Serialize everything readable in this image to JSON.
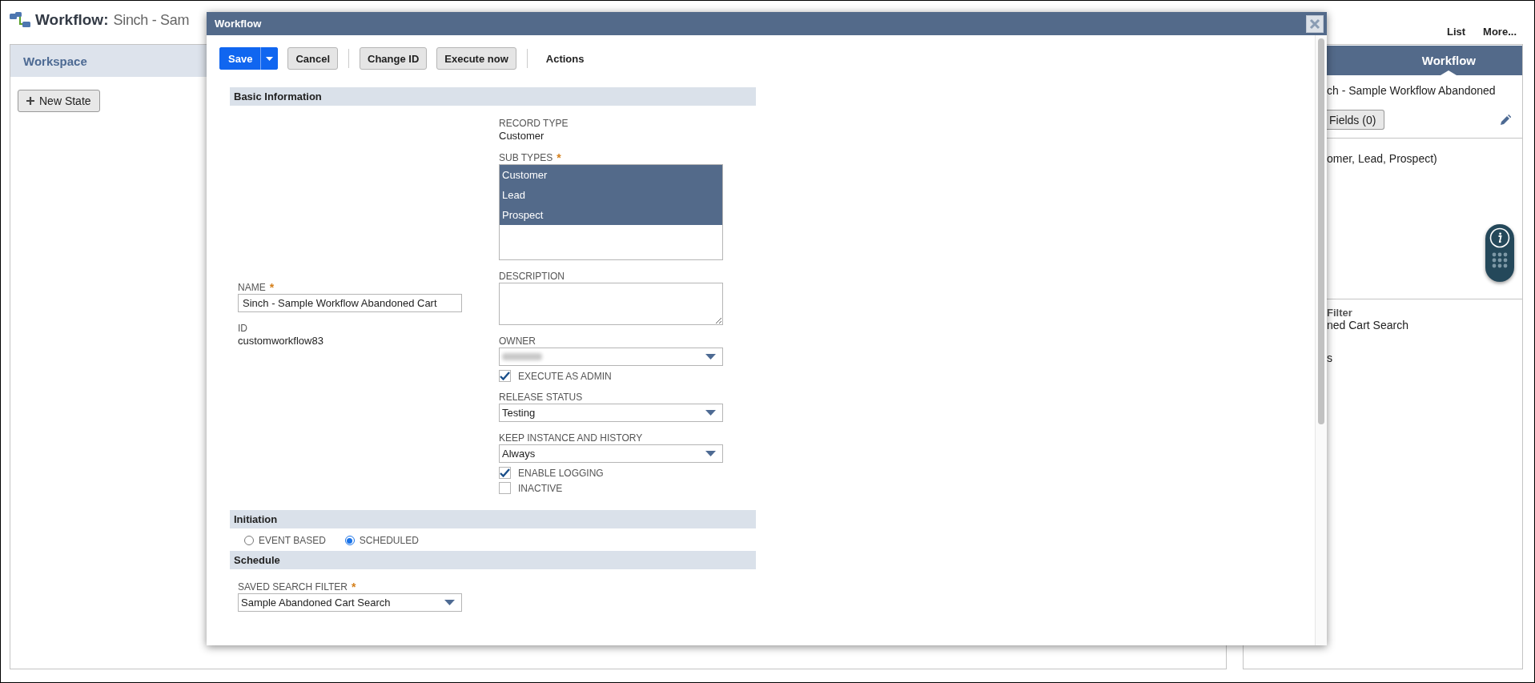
{
  "page_header": {
    "title": "Workflow:",
    "name": "Sinch - Sam"
  },
  "top_links": [
    "List",
    "More..."
  ],
  "workspace": {
    "title": "Workspace",
    "new_state_button": "New State"
  },
  "side_panel": {
    "tab": "Workflow",
    "name": "ch - Sample Workflow Abandoned",
    "fields_button": "Fields (0)",
    "sub_types": "omer, Lead, Prospect)",
    "filter_label": "Filter",
    "filter_value": "ned Cart Search",
    "text_3": "s"
  },
  "dialog": {
    "title": "Workflow",
    "toolbar": [
      [
        {
          "label": "Save",
          "kind": "split"
        },
        {
          "label": "Cancel",
          "kind": "button"
        }
      ],
      [
        {
          "label": "Change ID",
          "kind": "button"
        },
        {
          "label": "Execute now",
          "kind": "button"
        }
      ],
      [
        {
          "label": "Actions",
          "kind": "menu"
        }
      ]
    ],
    "sections": [
      {
        "title": "Basic Information",
        "kind": "columns",
        "left": [
          {
            "kind": "text",
            "label": "NAME",
            "required_mark": "*",
            "value": "Sinch - Sample Workflow Abandoned Cart"
          },
          {
            "kind": "static",
            "label": "ID",
            "value": "customworkflow83"
          }
        ],
        "right": [
          {
            "kind": "static",
            "label": "RECORD TYPE",
            "value": "Customer"
          },
          {
            "kind": "multiselect",
            "label": "SUB TYPES",
            "required_mark": "*",
            "options": [
              {
                "label": "Customer",
                "selected": true
              },
              {
                "label": "Lead",
                "selected": true
              },
              {
                "label": "Prospect",
                "selected": true
              }
            ]
          },
          {
            "kind": "textarea",
            "label": "DESCRIPTION"
          },
          {
            "kind": "select",
            "label": "OWNER",
            "value_blurred": true
          },
          {
            "kind": "checkbox",
            "label": "EXECUTE AS ADMIN",
            "checked": true
          },
          {
            "kind": "select",
            "label": "RELEASE STATUS",
            "value": "Testing"
          },
          {
            "kind": "select",
            "label": "KEEP INSTANCE AND HISTORY",
            "value": "Always"
          },
          {
            "kind": "checkbox",
            "label": "ENABLE LOGGING",
            "checked": true
          },
          {
            "kind": "checkbox",
            "label": "INACTIVE",
            "checked": false
          }
        ]
      },
      {
        "title": "Initiation",
        "kind": "radios",
        "options": [
          {
            "label": "EVENT BASED",
            "selected": false
          },
          {
            "label": "SCHEDULED",
            "selected": true
          }
        ]
      },
      {
        "title": "Schedule",
        "kind": "columns",
        "left": [
          {
            "kind": "select",
            "label": "SAVED SEARCH FILTER",
            "required_mark": "*",
            "value": "Sample Abandoned Cart Search"
          }
        ]
      }
    ]
  }
}
